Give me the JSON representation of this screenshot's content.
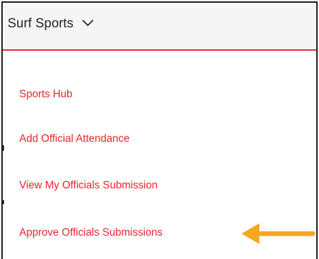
{
  "header": {
    "title": "Surf Sports",
    "dropdown_icon": "chevron-down-icon"
  },
  "menu": {
    "items": [
      {
        "label": "Sports Hub"
      },
      {
        "label": "Add Official Attendance"
      },
      {
        "label": "View My Officials Submission"
      },
      {
        "label": "Approve Officials Submissions"
      }
    ]
  },
  "annotation": {
    "icon": "arrow-left-icon",
    "color": "#f5a623"
  },
  "colors": {
    "accent": "#e8262a",
    "header_bg": "#f5f5f5",
    "text_dark": "#222222"
  }
}
